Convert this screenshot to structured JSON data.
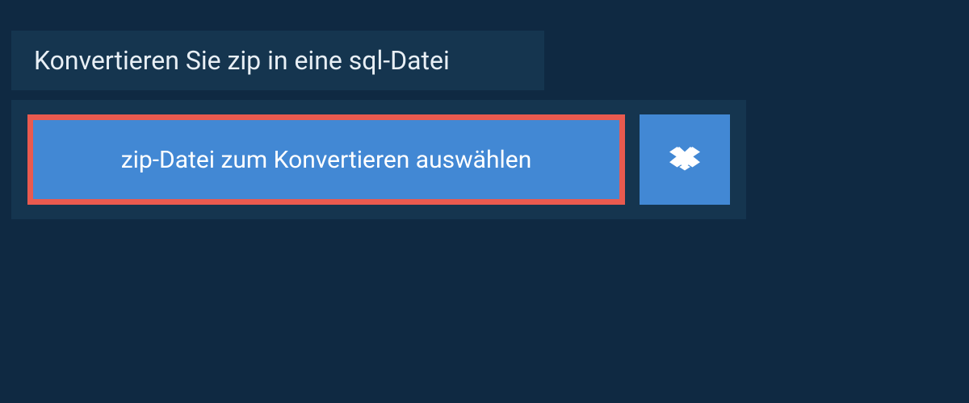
{
  "header": {
    "title": "Konvertieren Sie zip in eine sql-Datei"
  },
  "buttons": {
    "select_file_label": "zip-Datei zum Konvertieren auswählen"
  },
  "colors": {
    "background": "#0f2942",
    "panel": "#15354f",
    "button_primary": "#4288d4",
    "button_highlight_border": "#e95a4f",
    "text_light": "#e8eff5"
  }
}
